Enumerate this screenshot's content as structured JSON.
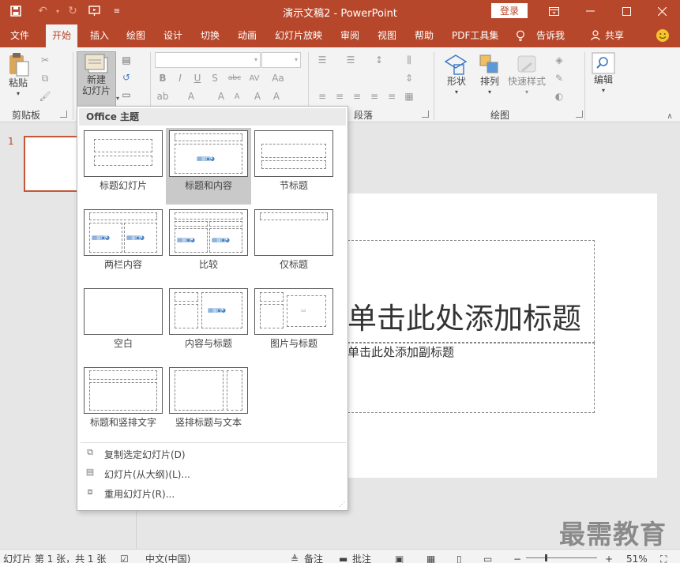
{
  "app": {
    "title": "演示文稿2 - PowerPoint",
    "login": "登录"
  },
  "qat_icons": [
    "save-icon",
    "undo-icon",
    "redo-icon",
    "start-from-beginning-icon",
    "customize-qat-icon"
  ],
  "tabs": [
    {
      "id": "file",
      "label": "文件"
    },
    {
      "id": "home",
      "label": "开始",
      "active": true
    },
    {
      "id": "insert",
      "label": "插入"
    },
    {
      "id": "draw",
      "label": "绘图"
    },
    {
      "id": "design",
      "label": "设计"
    },
    {
      "id": "transitions",
      "label": "切换"
    },
    {
      "id": "animations",
      "label": "动画"
    },
    {
      "id": "slideshow",
      "label": "幻灯片放映"
    },
    {
      "id": "review",
      "label": "审阅"
    },
    {
      "id": "view",
      "label": "视图"
    },
    {
      "id": "help",
      "label": "帮助"
    },
    {
      "id": "pdf",
      "label": "PDF工具集"
    },
    {
      "id": "tellme",
      "label": "告诉我"
    },
    {
      "id": "share",
      "label": "共享"
    }
  ],
  "ribbon": {
    "paste": "粘贴",
    "clipboard_group": "剪贴板",
    "new_slide_line1": "新建",
    "new_slide_line2": "幻灯片",
    "paragraph_group": "段落",
    "shapes": "形状",
    "arrange": "排列",
    "quick_styles": "快速样式",
    "drawing_group": "绘图",
    "editing": "编辑"
  },
  "slide_panel": {
    "slide_number": "1"
  },
  "slide": {
    "title_placeholder": "单击此处添加标题",
    "subtitle_placeholder": "单击此处添加副标题"
  },
  "layout_gallery": {
    "header": "Office 主题",
    "selected": "标题和内容",
    "layouts": [
      {
        "name": "标题幻灯片"
      },
      {
        "name": "标题和内容"
      },
      {
        "name": "节标题"
      },
      {
        "name": "两栏内容"
      },
      {
        "name": "比较"
      },
      {
        "name": "仅标题"
      },
      {
        "name": "空白"
      },
      {
        "name": "内容与标题"
      },
      {
        "name": "图片与标题"
      },
      {
        "name": "标题和竖排文字"
      },
      {
        "name": "竖排标题与文本"
      }
    ],
    "menu_items": [
      {
        "label": "复制选定幻灯片(D)",
        "icon": "duplicate-slide-icon"
      },
      {
        "label": "幻灯片(从大纲)(L)...",
        "icon": "slides-from-outline-icon"
      },
      {
        "label": "重用幻灯片(R)...",
        "icon": "reuse-slides-icon"
      }
    ]
  },
  "statusbar": {
    "slide_info": "幻灯片 第 1 张，共 1 张",
    "language": "中文(中国)",
    "notes": "备注",
    "comments": "批注",
    "zoom": "51%"
  },
  "watermark": "最需教育",
  "colors": {
    "accent": "#b7472a",
    "ribbon_bg": "#f3f3f3",
    "workspace_bg": "#e6e6e6",
    "selected_layout": "#c9c9c9"
  }
}
